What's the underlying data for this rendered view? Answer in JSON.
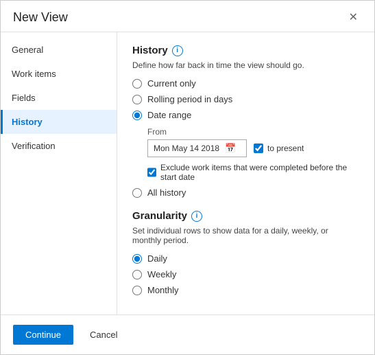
{
  "dialog": {
    "title": "New View",
    "close_label": "✕"
  },
  "sidebar": {
    "items": [
      {
        "id": "general",
        "label": "General",
        "active": false
      },
      {
        "id": "work-items",
        "label": "Work items",
        "active": false
      },
      {
        "id": "fields",
        "label": "Fields",
        "active": false
      },
      {
        "id": "history",
        "label": "History",
        "active": true
      },
      {
        "id": "verification",
        "label": "Verification",
        "active": false
      }
    ]
  },
  "history": {
    "section_title": "History",
    "description": "Define how far back in time the view should go.",
    "options": [
      {
        "id": "current-only",
        "label": "Current only",
        "checked": false
      },
      {
        "id": "rolling-period",
        "label": "Rolling period in days",
        "checked": false
      },
      {
        "id": "date-range",
        "label": "Date range",
        "checked": true
      },
      {
        "id": "all-history",
        "label": "All history",
        "checked": false
      }
    ],
    "from_label": "From",
    "date_value": "Mon May 14 2018",
    "to_present_label": "to present",
    "exclude_label": "Exclude work items that were completed before the start date"
  },
  "granularity": {
    "section_title": "Granularity",
    "description": "Set individual rows to show data for a daily, weekly, or monthly period.",
    "options": [
      {
        "id": "daily",
        "label": "Daily",
        "checked": true
      },
      {
        "id": "weekly",
        "label": "Weekly",
        "checked": false
      },
      {
        "id": "monthly",
        "label": "Monthly",
        "checked": false
      }
    ]
  },
  "footer": {
    "continue_label": "Continue",
    "cancel_label": "Cancel"
  }
}
